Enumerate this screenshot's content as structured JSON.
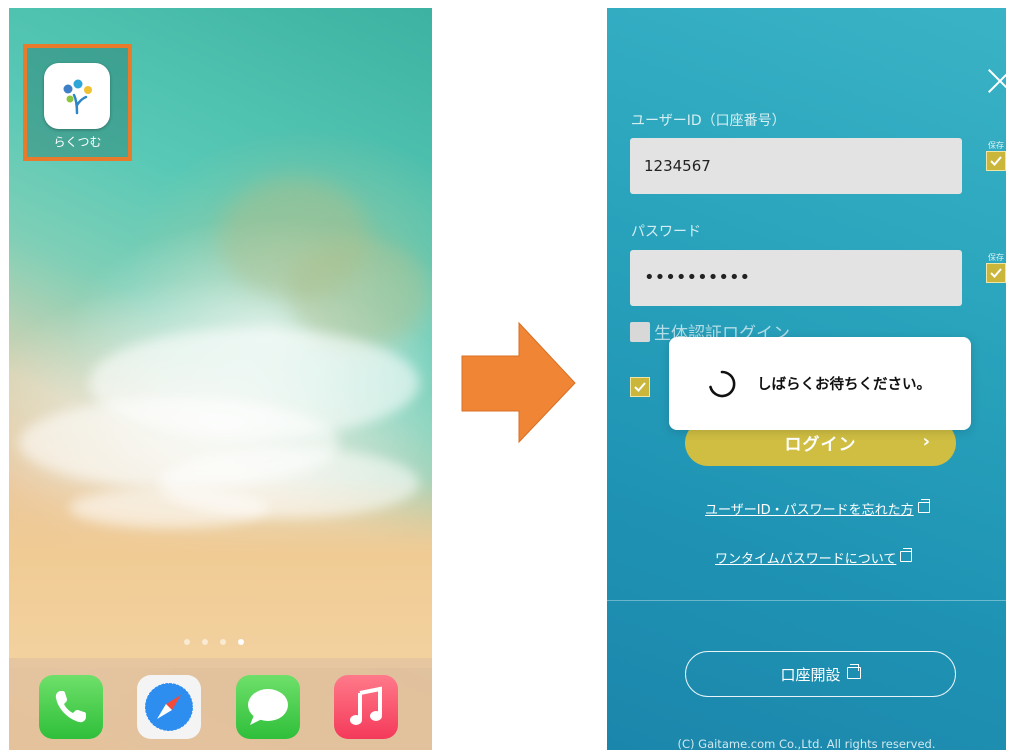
{
  "home_screen": {
    "app_label": "らくつむ",
    "page_dots": 4,
    "active_page_index": 3,
    "dock_apps": [
      "phone-icon",
      "safari-icon",
      "messages-icon",
      "music-icon"
    ],
    "colors": {
      "highlight": "#e87a2c"
    }
  },
  "arrow": {
    "color": "#f08536"
  },
  "login": {
    "user_id_label": "ユーザーID（口座番号）",
    "user_id_value": "1234567",
    "save_label": "保存",
    "password_label": "パスワード",
    "password_value": "••••••••••",
    "biometric_label": "生体認証ログイン",
    "login_button": "ログイン",
    "forgot_link": "ユーザーID・パスワードを忘れた方",
    "otp_link": "ワンタイムパスワードについて",
    "open_account_button": "口座開設",
    "copyright": "(C) Gaitame.com Co.,Ltd. All rights reserved.",
    "loading_message": "しばらくお待ちください。",
    "colors": {
      "background": "#1f93b4",
      "accent": "#cfbe42",
      "checkbox": "#c9b63a"
    }
  }
}
